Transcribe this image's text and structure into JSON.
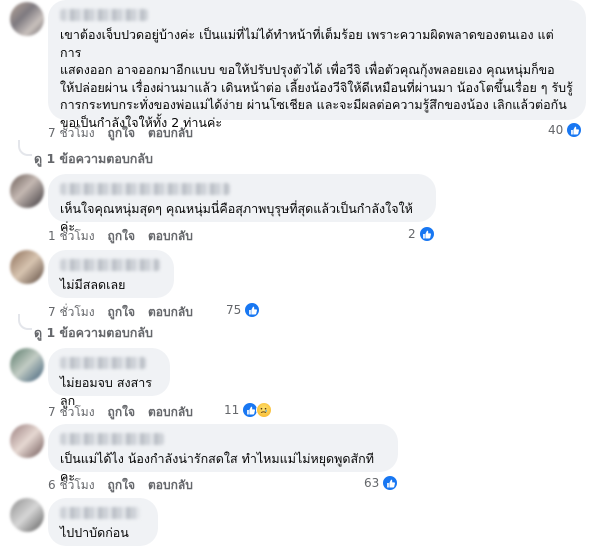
{
  "labels": {
    "like": "ถูกใจ",
    "reply": "ตอบกลับ"
  },
  "colors": {
    "link_gray": "#65676b",
    "bubble_bg": "#f0f2f5",
    "like_blue": "#1877f2"
  },
  "comments": [
    {
      "text": "เขาต้องเจ็บปวดอยู่บ้างค่ะ เป็นแม่ที่ไม่ได้ทำหน้าที่เต็มร้อย เพราะความผิดพลาดของตนเอง แต่การ\nแสดงออก อาจออกมาอีกแบบ ขอให้ปรับปรุงตัวได้ เพื่อวีจิ เพื่อตัวคุณกุ้งพลอยเอง คุณหนุ่มก็ขอ\nให้ปล่อยผ่าน เรื่องผ่านมาแล้ว เดินหน้าต่อ เลี้ยงน้องวีจิให้ดีเหมือนที่ผ่านมา น้องโตขึ้นเรื่อย ๆ รับรู้\nการกระทบกระทั่งของพ่อแม่ได้ง่าย ผ่านโซเชียล และจะมีผลต่อความรู้สึกของน้อง เลิกแล้วต่อกัน\nขอเป็นกำลังใจให้ทั้ง 2 ท่านค่ะ",
      "time": "7 ชั่วโมง",
      "reactions": "40",
      "replies_link": "ดู 1 ข้อความตอบกลับ"
    },
    {
      "text": "เห็นใจคุณหนุ่มสุดๆ คุณหนุ่มนี่คือสุภาพบุรุษที่สุดแล้วเป็นกำลังใจให้ค่ะ",
      "time": "1 ชั่วโมง",
      "reactions": "2"
    },
    {
      "text": "ไม่มีสลดเลย",
      "time": "7 ชั่วโมง",
      "reactions": "75",
      "replies_link": "ดู 1 ข้อความตอบกลับ"
    },
    {
      "text": "ไม่ยอมจบ สงสารลูก",
      "time": "7 ชั่วโมง",
      "reactions": "11"
    },
    {
      "text": "เป็นแม่ได้ไง น้องกำลังน่ารักสดใส ทำไหมแม่ไม่หยุดพูดสักทีคะ",
      "time": "6 ชั่วโมง",
      "reactions": "63"
    },
    {
      "text": "ไปปาบัดก่อน"
    }
  ]
}
